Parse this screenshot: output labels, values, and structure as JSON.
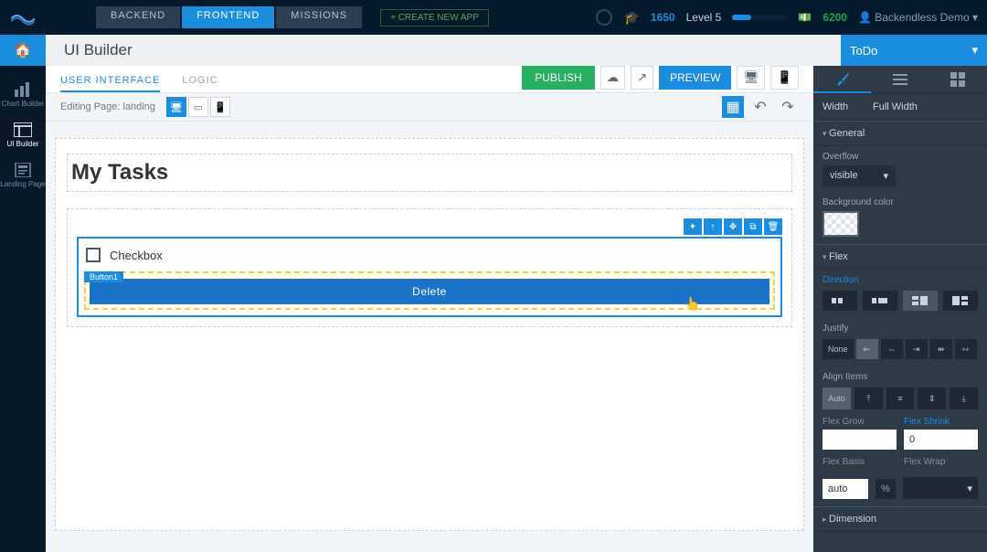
{
  "header": {
    "tabs": {
      "backend": "BACKEND",
      "frontend": "FRONTEND",
      "missions": "MISSIONS"
    },
    "create_app": "+ CREATE NEW APP",
    "xp": "1650",
    "level": "Level 5",
    "coins": "6200",
    "user": "Backendless Demo"
  },
  "subheader": {
    "title": "UI Builder",
    "project": "ToDo"
  },
  "leftrail": {
    "chart": "Chart Builder",
    "ui": "UI Builder",
    "landing": "Landing Page"
  },
  "tabs2": {
    "ui": "USER INTERFACE",
    "logic": "LOGIC"
  },
  "toolbar": {
    "publish": "PUBLISH",
    "preview": "PREVIEW"
  },
  "editrow": {
    "label": "Editing Page:",
    "page": "landing"
  },
  "canvas": {
    "title": "My Tasks",
    "checkbox_label": "Checkbox",
    "button_tag": "Button1",
    "button_label": "Delete"
  },
  "rp": {
    "width_label": "Width",
    "width_value": "Full Width",
    "sec_general": "General",
    "overflow_label": "Overflow",
    "overflow_value": "visible",
    "bg_label": "Background color",
    "sec_flex": "Flex",
    "direction_label": "Direction",
    "justify_label": "Justify",
    "justify_none": "None",
    "align_label": "Align Items",
    "align_auto": "Auto",
    "grow_label": "Flex Grow",
    "grow_value": "",
    "shrink_label": "Flex Shrink",
    "shrink_value": "0",
    "basis_label": "Flex Basis",
    "basis_value": "auto",
    "basis_unit": "%",
    "wrap_label": "Flex Wrap",
    "sec_dimension": "Dimension"
  }
}
